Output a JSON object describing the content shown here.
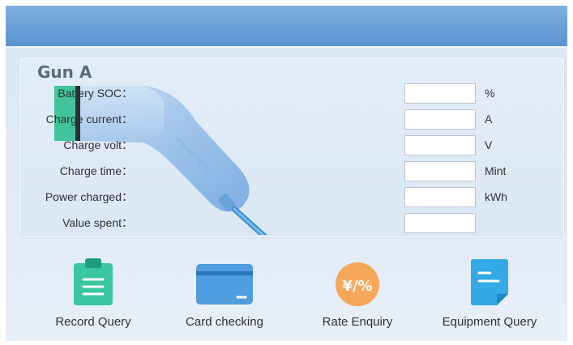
{
  "gun": {
    "title": "Gun A"
  },
  "fields": [
    {
      "label": "Battery SOC：",
      "value": "",
      "unit": "%"
    },
    {
      "label": "Charge current：",
      "value": "",
      "unit": "A"
    },
    {
      "label": "Charge volt：",
      "value": "",
      "unit": "V"
    },
    {
      "label": "Charge time：",
      "value": "",
      "unit": "Mint"
    },
    {
      "label": "Power charged：",
      "value": "",
      "unit": "kWh"
    },
    {
      "label": "Value spent：",
      "value": "",
      "unit": ""
    }
  ],
  "functions": [
    {
      "label": "Record Query",
      "icon": "clipboard-icon"
    },
    {
      "label": "Card checking",
      "icon": "card-icon"
    },
    {
      "label": "Rate Enquiry",
      "icon": "rate-icon",
      "icon_text": "¥/%"
    },
    {
      "label": "Equipment Query",
      "icon": "document-icon"
    }
  ],
  "colors": {
    "header": "#5b92cf",
    "record_icon": "#2dbf9a",
    "card_icon": "#3d8fd8",
    "rate_icon": "#f19a45",
    "equipment_icon": "#33a9e6"
  }
}
